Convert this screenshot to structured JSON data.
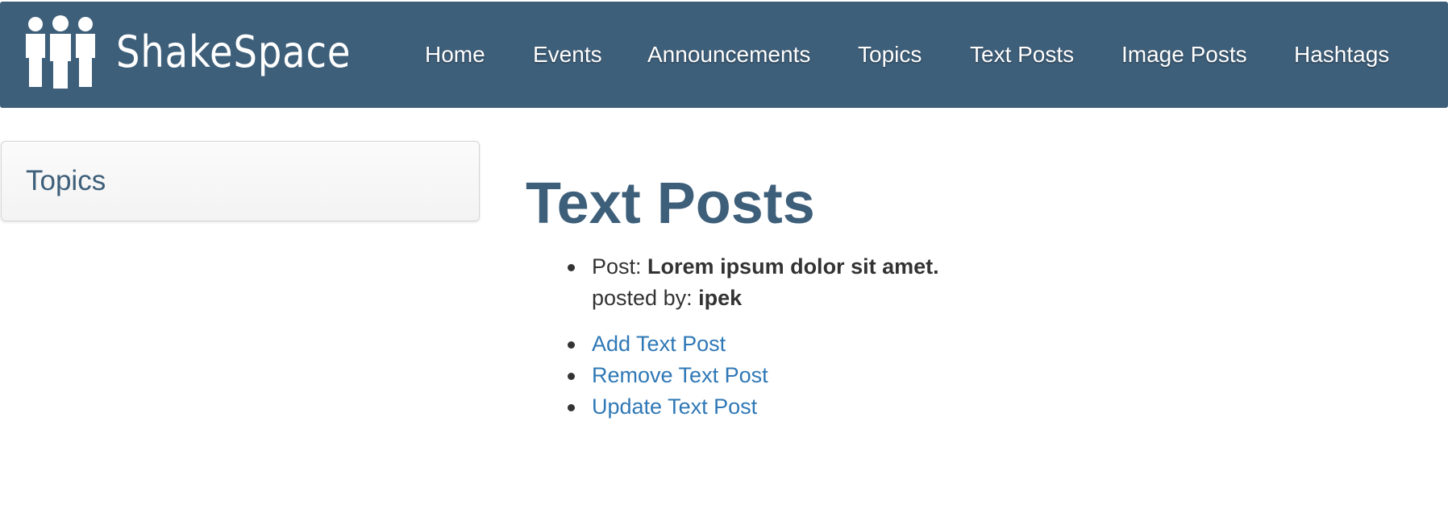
{
  "navbar": {
    "brand": "ShakeSpace",
    "logo_icon": "people-group-icon",
    "background_color": "#3e5f7a",
    "items": [
      {
        "label": "Home"
      },
      {
        "label": "Events"
      },
      {
        "label": "Announcements"
      },
      {
        "label": "Topics"
      },
      {
        "label": "Text Posts"
      },
      {
        "label": "Image Posts"
      },
      {
        "label": "Hashtags"
      }
    ]
  },
  "sidebar": {
    "title": "Topics"
  },
  "main": {
    "title": "Text Posts",
    "title_color": "#3e5f7a",
    "posts": [
      {
        "post_label": "Post:",
        "post_text": "Lorem ipsum dolor sit amet.",
        "by_label": "posted by:",
        "author": "ipek"
      }
    ],
    "actions": [
      {
        "label": "Add Text Post"
      },
      {
        "label": "Remove Text Post"
      },
      {
        "label": "Update Text Post"
      }
    ],
    "link_color": "#2f78b6"
  }
}
